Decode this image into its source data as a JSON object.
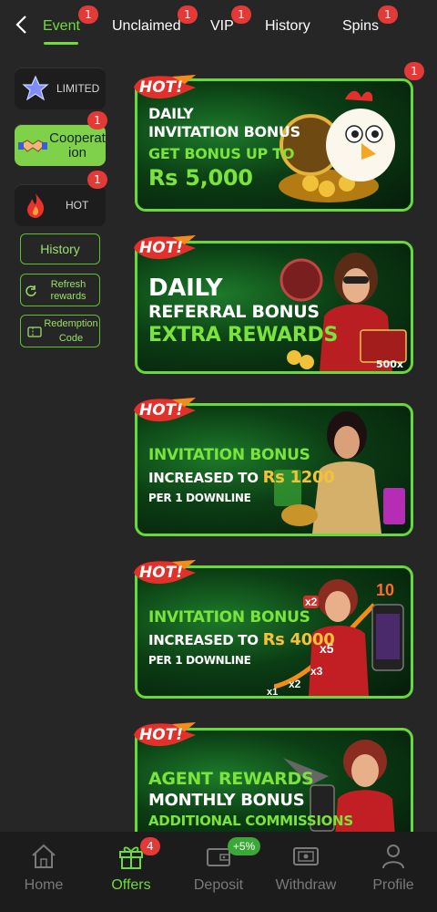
{
  "tabs": [
    {
      "label": "Event",
      "badge": "1",
      "active": true
    },
    {
      "label": "Unclaimed",
      "badge": "1"
    },
    {
      "label": "VIP",
      "badge": "1"
    },
    {
      "label": "History",
      "badge": ""
    },
    {
      "label": "Spins",
      "badge": "1"
    }
  ],
  "sidebar": {
    "categories": [
      {
        "label": "LIMITED",
        "badge": ""
      },
      {
        "label": "Cooperation",
        "badge": "1"
      },
      {
        "label": "HOT",
        "badge": "1"
      }
    ],
    "buttons": {
      "history": "History",
      "refresh_line1": "Refresh",
      "refresh_line2": "rewards",
      "redemption_line1": "Redemption",
      "redemption_line2": "Code"
    }
  },
  "banners": [
    {
      "hot": "HOT!",
      "badge": "1",
      "l1": "DAILY",
      "l2": "INVITATION BONUS",
      "l3": "GET BONUS UP TO",
      "l4": "Rs 5,000"
    },
    {
      "hot": "HOT!",
      "l1": "DAILY",
      "l2": "REFERRAL BONUS",
      "l3": "EXTRA REWARDS",
      "art_text": "500x"
    },
    {
      "hot": "HOT!",
      "l1": "INVITATION BONUS",
      "l2a": "INCREASED TO ",
      "l2b": "Rs 1200",
      "l3": "PER 1 DOWNLINE"
    },
    {
      "hot": "HOT!",
      "l1": "INVITATION BONUS",
      "l2a": "INCREASED TO ",
      "l2b": "Rs 4000",
      "l3": "PER 1 DOWNLINE",
      "mults": [
        "x2",
        "x5",
        "x3",
        "x2",
        "x1",
        "10"
      ]
    },
    {
      "hot": "HOT!",
      "l1": "AGENT REWARDS",
      "l2": "MONTHLY BONUS",
      "l3": "ADDITIONAL COMMISSIONS"
    }
  ],
  "bottom_nav": [
    {
      "label": "Home",
      "icon": "home-icon"
    },
    {
      "label": "Offers",
      "icon": "gift-icon",
      "badge": "4",
      "active": true
    },
    {
      "label": "Deposit",
      "icon": "wallet-icon",
      "badge": "+5%"
    },
    {
      "label": "Withdraw",
      "icon": "cash-icon"
    },
    {
      "label": "Profile",
      "icon": "person-icon"
    }
  ],
  "colors": {
    "accent": "#6fdc3a",
    "badge": "#e23a36",
    "background": "#262626"
  }
}
